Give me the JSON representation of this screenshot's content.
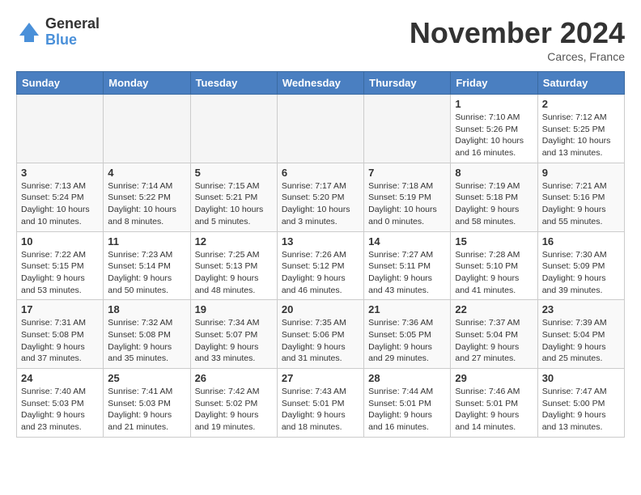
{
  "header": {
    "logo_general": "General",
    "logo_blue": "Blue",
    "month_title": "November 2024",
    "location": "Carces, France"
  },
  "calendar": {
    "columns": [
      "Sunday",
      "Monday",
      "Tuesday",
      "Wednesday",
      "Thursday",
      "Friday",
      "Saturday"
    ],
    "rows": [
      [
        {
          "day": "",
          "info": ""
        },
        {
          "day": "",
          "info": ""
        },
        {
          "day": "",
          "info": ""
        },
        {
          "day": "",
          "info": ""
        },
        {
          "day": "",
          "info": ""
        },
        {
          "day": "1",
          "info": "Sunrise: 7:10 AM\nSunset: 5:26 PM\nDaylight: 10 hours and 16 minutes."
        },
        {
          "day": "2",
          "info": "Sunrise: 7:12 AM\nSunset: 5:25 PM\nDaylight: 10 hours and 13 minutes."
        }
      ],
      [
        {
          "day": "3",
          "info": "Sunrise: 7:13 AM\nSunset: 5:24 PM\nDaylight: 10 hours and 10 minutes."
        },
        {
          "day": "4",
          "info": "Sunrise: 7:14 AM\nSunset: 5:22 PM\nDaylight: 10 hours and 8 minutes."
        },
        {
          "day": "5",
          "info": "Sunrise: 7:15 AM\nSunset: 5:21 PM\nDaylight: 10 hours and 5 minutes."
        },
        {
          "day": "6",
          "info": "Sunrise: 7:17 AM\nSunset: 5:20 PM\nDaylight: 10 hours and 3 minutes."
        },
        {
          "day": "7",
          "info": "Sunrise: 7:18 AM\nSunset: 5:19 PM\nDaylight: 10 hours and 0 minutes."
        },
        {
          "day": "8",
          "info": "Sunrise: 7:19 AM\nSunset: 5:18 PM\nDaylight: 9 hours and 58 minutes."
        },
        {
          "day": "9",
          "info": "Sunrise: 7:21 AM\nSunset: 5:16 PM\nDaylight: 9 hours and 55 minutes."
        }
      ],
      [
        {
          "day": "10",
          "info": "Sunrise: 7:22 AM\nSunset: 5:15 PM\nDaylight: 9 hours and 53 minutes."
        },
        {
          "day": "11",
          "info": "Sunrise: 7:23 AM\nSunset: 5:14 PM\nDaylight: 9 hours and 50 minutes."
        },
        {
          "day": "12",
          "info": "Sunrise: 7:25 AM\nSunset: 5:13 PM\nDaylight: 9 hours and 48 minutes."
        },
        {
          "day": "13",
          "info": "Sunrise: 7:26 AM\nSunset: 5:12 PM\nDaylight: 9 hours and 46 minutes."
        },
        {
          "day": "14",
          "info": "Sunrise: 7:27 AM\nSunset: 5:11 PM\nDaylight: 9 hours and 43 minutes."
        },
        {
          "day": "15",
          "info": "Sunrise: 7:28 AM\nSunset: 5:10 PM\nDaylight: 9 hours and 41 minutes."
        },
        {
          "day": "16",
          "info": "Sunrise: 7:30 AM\nSunset: 5:09 PM\nDaylight: 9 hours and 39 minutes."
        }
      ],
      [
        {
          "day": "17",
          "info": "Sunrise: 7:31 AM\nSunset: 5:08 PM\nDaylight: 9 hours and 37 minutes."
        },
        {
          "day": "18",
          "info": "Sunrise: 7:32 AM\nSunset: 5:08 PM\nDaylight: 9 hours and 35 minutes."
        },
        {
          "day": "19",
          "info": "Sunrise: 7:34 AM\nSunset: 5:07 PM\nDaylight: 9 hours and 33 minutes."
        },
        {
          "day": "20",
          "info": "Sunrise: 7:35 AM\nSunset: 5:06 PM\nDaylight: 9 hours and 31 minutes."
        },
        {
          "day": "21",
          "info": "Sunrise: 7:36 AM\nSunset: 5:05 PM\nDaylight: 9 hours and 29 minutes."
        },
        {
          "day": "22",
          "info": "Sunrise: 7:37 AM\nSunset: 5:04 PM\nDaylight: 9 hours and 27 minutes."
        },
        {
          "day": "23",
          "info": "Sunrise: 7:39 AM\nSunset: 5:04 PM\nDaylight: 9 hours and 25 minutes."
        }
      ],
      [
        {
          "day": "24",
          "info": "Sunrise: 7:40 AM\nSunset: 5:03 PM\nDaylight: 9 hours and 23 minutes."
        },
        {
          "day": "25",
          "info": "Sunrise: 7:41 AM\nSunset: 5:03 PM\nDaylight: 9 hours and 21 minutes."
        },
        {
          "day": "26",
          "info": "Sunrise: 7:42 AM\nSunset: 5:02 PM\nDaylight: 9 hours and 19 minutes."
        },
        {
          "day": "27",
          "info": "Sunrise: 7:43 AM\nSunset: 5:01 PM\nDaylight: 9 hours and 18 minutes."
        },
        {
          "day": "28",
          "info": "Sunrise: 7:44 AM\nSunset: 5:01 PM\nDaylight: 9 hours and 16 minutes."
        },
        {
          "day": "29",
          "info": "Sunrise: 7:46 AM\nSunset: 5:01 PM\nDaylight: 9 hours and 14 minutes."
        },
        {
          "day": "30",
          "info": "Sunrise: 7:47 AM\nSunset: 5:00 PM\nDaylight: 9 hours and 13 minutes."
        }
      ]
    ]
  }
}
